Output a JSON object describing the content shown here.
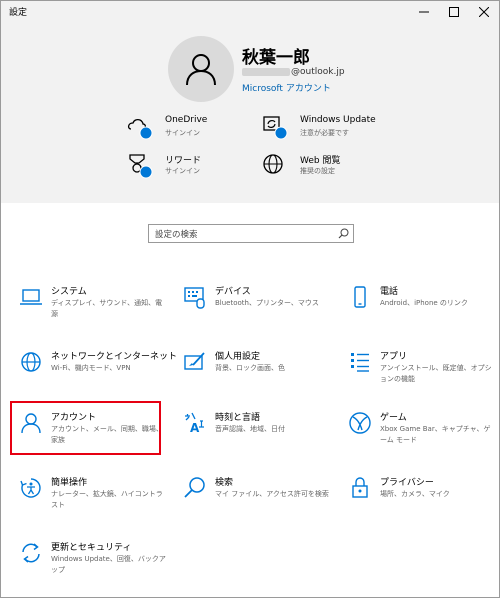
{
  "window": {
    "title": "設定"
  },
  "account": {
    "name": "秋葉一郎",
    "email_suffix": "@outlook.jp",
    "link": "Microsoft アカウント"
  },
  "header_items": [
    {
      "label": "OneDrive",
      "sub": "サインイン",
      "icon": "onedrive-icon"
    },
    {
      "label": "Windows Update",
      "sub": "注意が必要です",
      "icon": "windows-update-icon"
    },
    {
      "label": "リワード",
      "sub": "サインイン",
      "icon": "rewards-icon"
    },
    {
      "label": "Web 閲覧",
      "sub": "推奨の設定",
      "icon": "globe-icon"
    }
  ],
  "search": {
    "placeholder": "設定の検索"
  },
  "categories": [
    {
      "name": "システム",
      "desc": "ディスプレイ、サウンド、通知、電源",
      "icon": "laptop-icon"
    },
    {
      "name": "デバイス",
      "desc": "Bluetooth、プリンター、マウス",
      "icon": "keyboard-icon"
    },
    {
      "name": "電話",
      "desc": "Android、iPhone のリンク",
      "icon": "phone-icon"
    },
    {
      "name": "ネットワークとインターネット",
      "desc": "Wi-Fi、機内モード、VPN",
      "icon": "network-globe-icon"
    },
    {
      "name": "個人用設定",
      "desc": "背景、ロック画面、色",
      "icon": "personalization-icon"
    },
    {
      "name": "アプリ",
      "desc": "アンインストール、既定値、オプションの機能",
      "icon": "apps-list-icon"
    },
    {
      "name": "アカウント",
      "desc": "アカウント、メール、同期、職場、家族",
      "icon": "person-icon"
    },
    {
      "name": "時刻と言語",
      "desc": "音声認識、地域、日付",
      "icon": "time-language-icon"
    },
    {
      "name": "ゲーム",
      "desc": "Xbox Game Bar、キャプチャ、ゲーム モード",
      "icon": "xbox-icon"
    },
    {
      "name": "簡単操作",
      "desc": "ナレーター、拡大鏡、ハイコントラスト",
      "icon": "ease-of-access-icon"
    },
    {
      "name": "検索",
      "desc": "マイ ファイル、アクセス許可を検索",
      "icon": "search-icon"
    },
    {
      "name": "プライバシー",
      "desc": "場所、カメラ、マイク",
      "icon": "lock-icon"
    },
    {
      "name": "更新とセキュリティ",
      "desc": "Windows Update、回復、バックアップ",
      "icon": "update-sync-icon"
    }
  ],
  "colors": {
    "accent": "#0078d7",
    "header_bg": "#f2f2f2",
    "highlight": "#e60012"
  }
}
